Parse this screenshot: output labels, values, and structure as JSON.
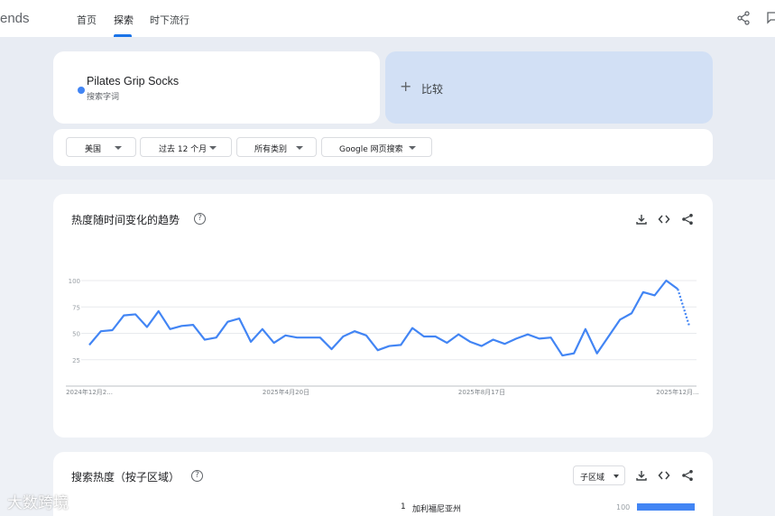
{
  "header": {
    "brand": "ends",
    "tabs": [
      {
        "label": "首页",
        "active": false
      },
      {
        "label": "探索",
        "active": true
      },
      {
        "label": "时下流行",
        "active": false
      }
    ]
  },
  "search": {
    "term": "Pilates Grip Socks",
    "term_sub": "搜索字词",
    "term_color": "#4285f4",
    "compare_label": "比较",
    "compare_plus": "+"
  },
  "filters": [
    {
      "label": "美国"
    },
    {
      "label": "过去 12 个月"
    },
    {
      "label": "所有类别"
    },
    {
      "label": "Google 网页搜索"
    }
  ],
  "trend": {
    "title": "热度随时间变化的趋势",
    "help": "?"
  },
  "chart_data": {
    "type": "line",
    "x_tick_labels": [
      "2024年12月2...",
      "2025年4月20日",
      "2025年8月17日",
      "2025年12月..."
    ],
    "y_ticks": [
      100,
      75,
      50,
      25
    ],
    "ylim": [
      0,
      100
    ],
    "grid": true,
    "series": [
      {
        "color": "#4285f4",
        "values": [
          39,
          52,
          53,
          67,
          68,
          56,
          71,
          54,
          57,
          58,
          44,
          46,
          61,
          64,
          42,
          54,
          41,
          48,
          46,
          46,
          46,
          35,
          47,
          52,
          48,
          34,
          38,
          39,
          55,
          47,
          47,
          41,
          49,
          42,
          38,
          44,
          40,
          45,
          49,
          45,
          46,
          29,
          31,
          54,
          31,
          47,
          63,
          69,
          89,
          86,
          100,
          92,
          57
        ],
        "partial_from_index": 51
      }
    ]
  },
  "region": {
    "title": "搜索热度（按子区域）",
    "help": "?",
    "subregion_label": "子区域",
    "rows": [
      {
        "rank": "1",
        "name": "加利福尼亚州",
        "value": "100",
        "fraction": 1.0
      }
    ]
  },
  "watermark": "大数跨境"
}
